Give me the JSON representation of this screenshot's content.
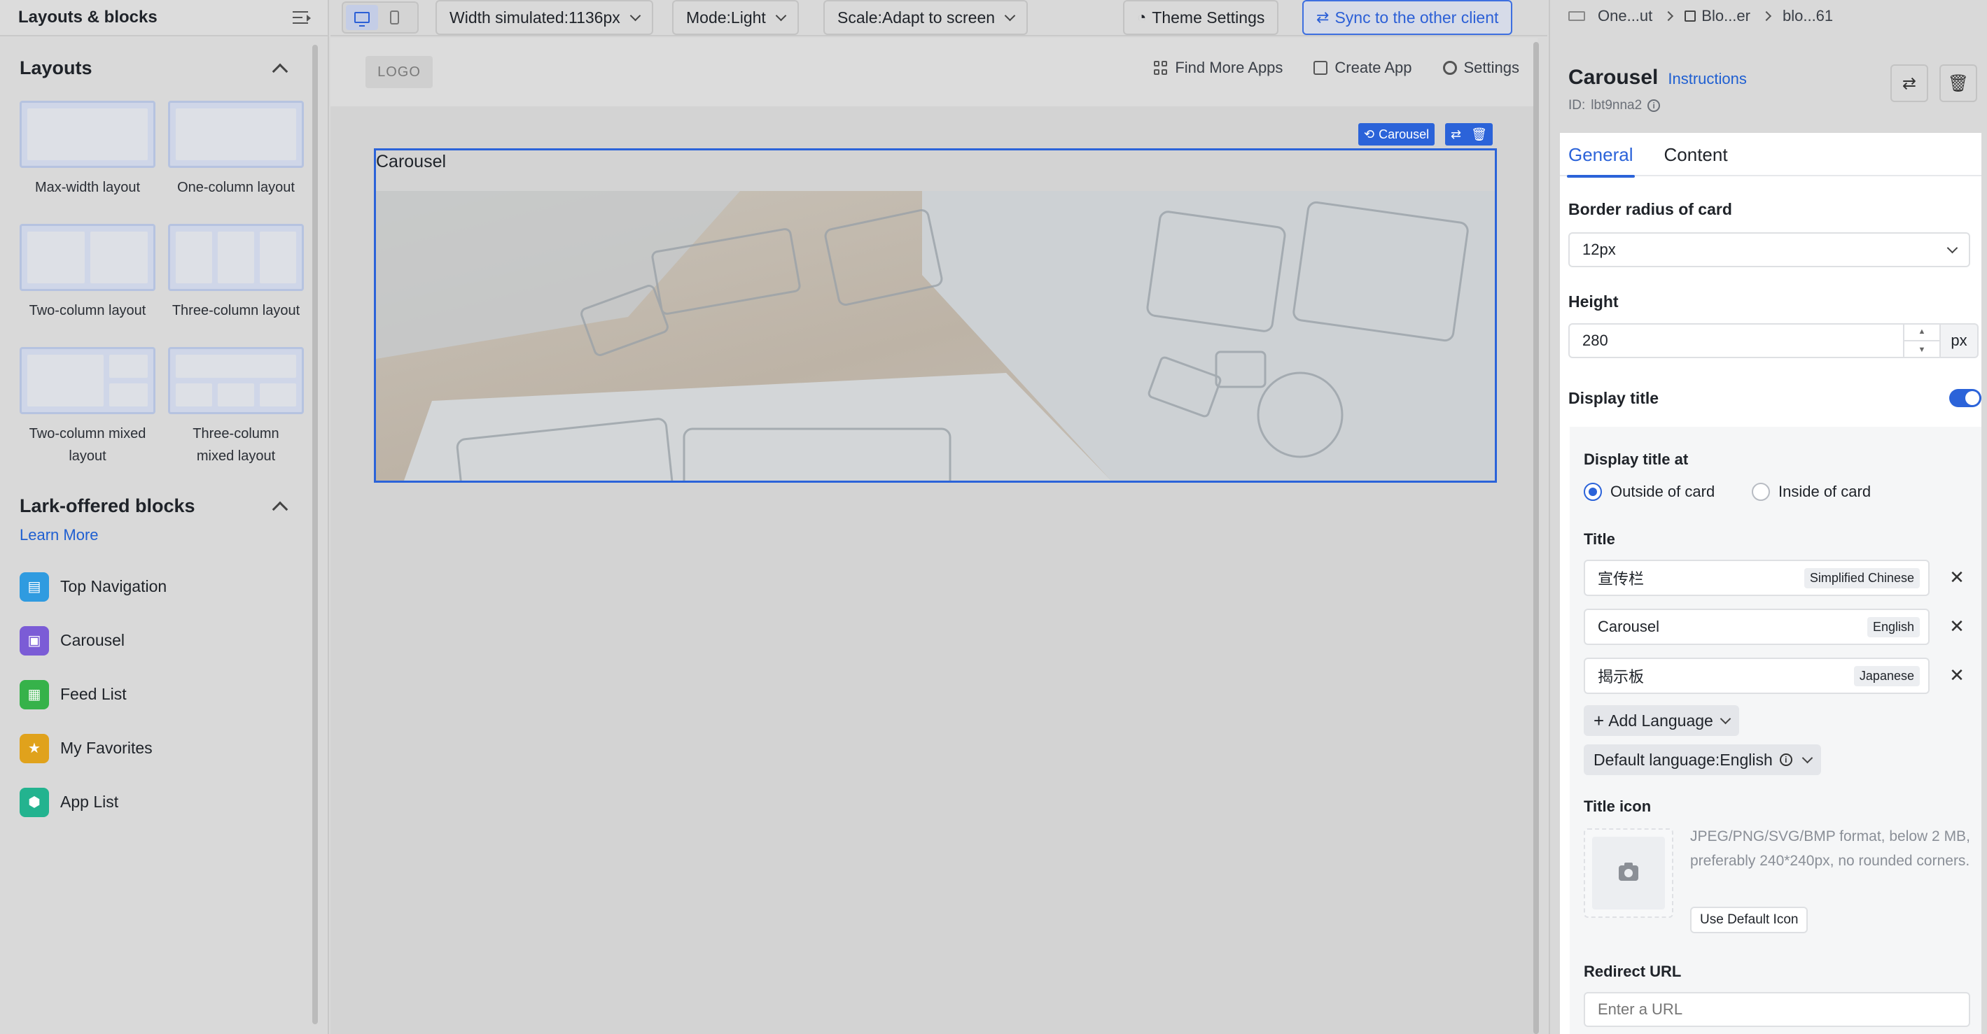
{
  "left_panel": {
    "header": "Layouts & blocks",
    "layouts_section_title": "Layouts",
    "layouts": [
      {
        "label": "Max-width layout"
      },
      {
        "label": "One-column layout"
      },
      {
        "label": "Two-column layout"
      },
      {
        "label": "Three-column layout"
      },
      {
        "label": "Two-column mixed layout"
      },
      {
        "label": "Three-column mixed layout"
      }
    ],
    "blocks_section_title": "Lark-offered blocks",
    "learn_more": "Learn More",
    "blocks": [
      {
        "label": "Top Navigation",
        "icon": "top-navigation-icon",
        "color": "#2f9be0"
      },
      {
        "label": "Carousel",
        "icon": "carousel-icon",
        "color": "#7b5cd6"
      },
      {
        "label": "Feed List",
        "icon": "feed-list-icon",
        "color": "#36b24a"
      },
      {
        "label": "My Favorites",
        "icon": "favorites-icon",
        "color": "#e0a21c"
      },
      {
        "label": "App List",
        "icon": "app-list-icon",
        "color": "#23b38f"
      }
    ]
  },
  "toolbar": {
    "width_select": "Width simulated:1136px",
    "mode_select": "Mode:Light",
    "scale_select": "Scale:Adapt to screen",
    "theme_settings": "Theme Settings",
    "sync_button": "Sync to the other client"
  },
  "canvas": {
    "logo": "LOGO",
    "nav": {
      "find_more_apps": "Find More Apps",
      "create_app": "Create App",
      "settings": "Settings"
    },
    "selection_tag": "Carousel",
    "carousel_title": "Carousel"
  },
  "right_panel": {
    "breadcrumb": [
      "One...ut",
      "Blo...er",
      "blo...61"
    ],
    "component_title": "Carousel",
    "instructions": "Instructions",
    "id_label": "ID:",
    "id_value": "lbt9nna2",
    "tabs": [
      "General",
      "Content"
    ],
    "border_radius_label": "Border radius of card",
    "border_radius_value": "12px",
    "height_label": "Height",
    "height_value": "280",
    "height_unit": "px",
    "display_title_label": "Display title",
    "display_title_on": true,
    "display_title_at_label": "Display title at",
    "display_title_options": [
      "Outside of card",
      "Inside of card"
    ],
    "display_title_selected": "Outside of card",
    "title_label": "Title",
    "title_langs": [
      {
        "value": "宣传栏",
        "lang": "Simplified Chinese"
      },
      {
        "value": "Carousel",
        "lang": "English"
      },
      {
        "value": "揭示板",
        "lang": "Japanese"
      }
    ],
    "add_language": "Add Language",
    "default_language": "Default language:English",
    "title_icon_label": "Title icon",
    "title_icon_hint": "JPEG/PNG/SVG/BMP format, below 2 MB, preferably 240*240px, no rounded corners.",
    "use_default_icon": "Use Default Icon",
    "redirect_url_label": "Redirect URL",
    "redirect_url_placeholder": "Enter a URL"
  },
  "colors": {
    "accent": "#2b63d9",
    "link": "#1f5fd1"
  }
}
